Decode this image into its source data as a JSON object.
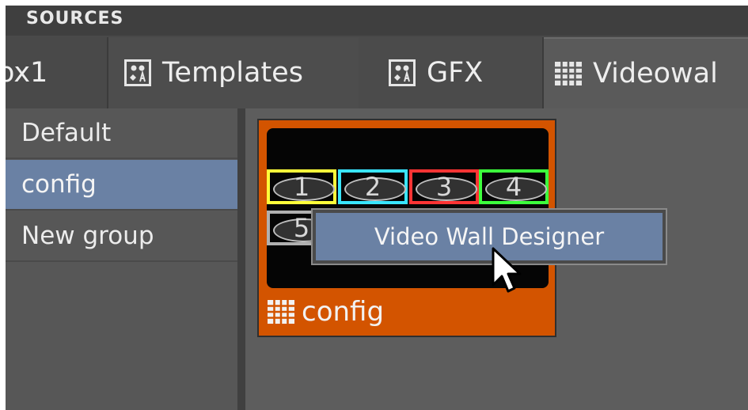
{
  "header": {
    "title": "SOURCES"
  },
  "tabs": [
    {
      "label": "ox1",
      "icon": "none"
    },
    {
      "label": "Templates",
      "icon": "template-icon"
    },
    {
      "label": "GFX",
      "icon": "template-icon"
    },
    {
      "label": "Videowal",
      "icon": "videowall-icon"
    }
  ],
  "sidebar": {
    "items": [
      {
        "label": "Default",
        "selected": false
      },
      {
        "label": "config",
        "selected": true
      },
      {
        "label": "New group",
        "selected": false
      }
    ]
  },
  "tile": {
    "label": "config",
    "icon": "videowall-icon",
    "background": "#d35400",
    "screens": [
      {
        "number": "1",
        "color": "#ffff3a"
      },
      {
        "number": "2",
        "color": "#39e5ff"
      },
      {
        "number": "3",
        "color": "#ff3434"
      },
      {
        "number": "4",
        "color": "#3cff3c"
      },
      {
        "number": "5",
        "color": "#b0b0b0"
      }
    ]
  },
  "context_menu": {
    "items": [
      {
        "label": "Video Wall Designer",
        "highlighted": true
      }
    ]
  },
  "colors": {
    "accent": "#6a81a4",
    "tile_bg": "#d35400"
  }
}
